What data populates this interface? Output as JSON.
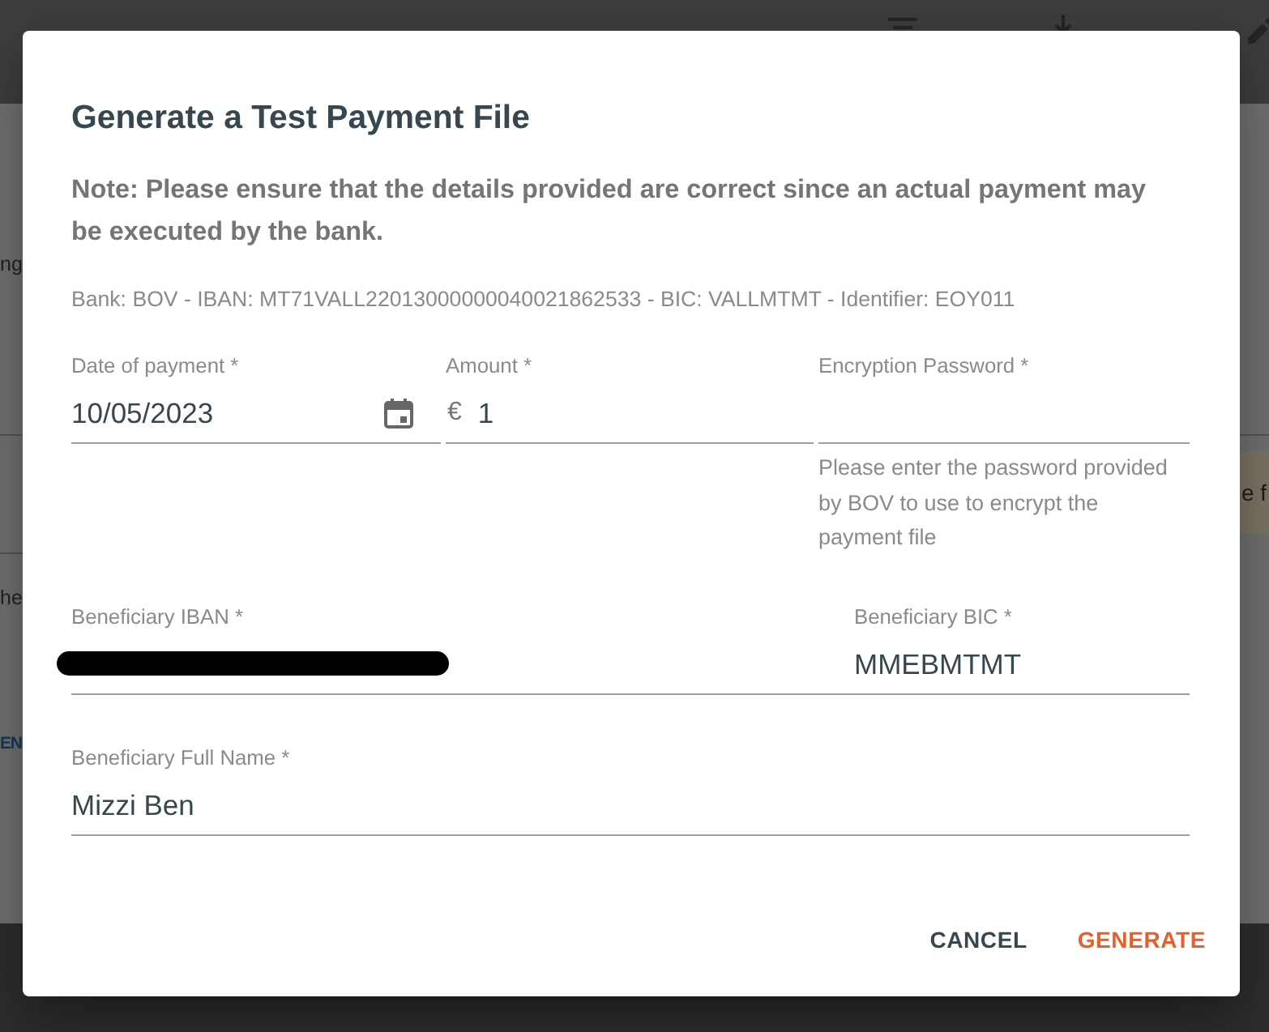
{
  "background": {
    "toolbar": [
      {
        "kind": "filter"
      },
      {
        "kind": "download"
      },
      {
        "kind": "edit"
      }
    ],
    "left_fragments": [
      {
        "kind": "text",
        "text": "ng"
      },
      {
        "kind": "text",
        "text": "he"
      },
      {
        "kind": "link",
        "text": "EN"
      }
    ],
    "right_fragments": [
      {
        "kind": "banner",
        "text": "e f"
      }
    ]
  },
  "dialog": {
    "title": "Generate a Test Payment File",
    "note": "Note: Please ensure that the details provided are correct since an actual payment may be executed by the bank.",
    "bank_details": "Bank: BOV - IBAN: MT71VALL22013000000040021862533 - BIC: VALLMTMT - Identifier: EOY011",
    "rows": [
      {
        "fields": [
          {
            "kind": "date",
            "label": "Date of payment *",
            "value": "10/05/2023"
          },
          {
            "kind": "amount",
            "label": "Amount *",
            "prefix": "€",
            "value": "1"
          },
          {
            "kind": "password",
            "label": "Encryption Password *",
            "hint": "Please enter the password provided by BOV to use to encrypt the payment file"
          }
        ]
      },
      {
        "fields": [
          {
            "kind": "text",
            "label": "Beneficiary IBAN *",
            "redacted": true
          },
          {
            "kind": "text",
            "label": "Beneficiary BIC *",
            "value": "MMEBMTMT"
          }
        ]
      },
      {
        "fields": [
          {
            "kind": "text",
            "label": "Beneficiary Full Name *",
            "value": "Mizzi Ben"
          }
        ]
      }
    ],
    "buttons": [
      {
        "kind": "secondary",
        "label": "CANCEL"
      },
      {
        "kind": "primary",
        "label": "GENERATE"
      }
    ]
  }
}
